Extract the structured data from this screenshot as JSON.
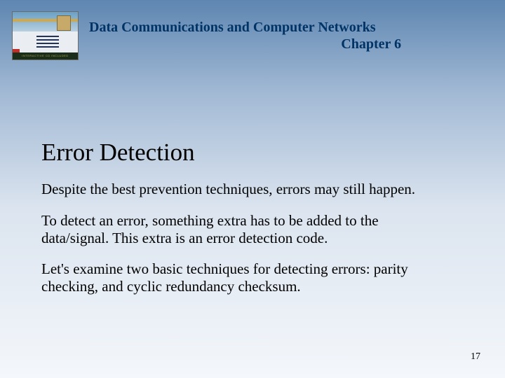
{
  "header": {
    "course_title": "Data Communications and Computer Networks",
    "chapter": "Chapter 6"
  },
  "slide": {
    "title": "Error Detection",
    "paragraphs": [
      "Despite the best prevention techniques, errors may still happen.",
      "To detect an error, something extra has to be added to the data/signal.  This extra is an error detection code.",
      "Let's examine two basic techniques for detecting errors: parity checking, and cyclic redundancy checksum."
    ]
  },
  "footer": {
    "page_number": "17"
  },
  "decorative": {
    "thumb_bottom_text": "INTERACTIVE CD INCLUDED"
  }
}
